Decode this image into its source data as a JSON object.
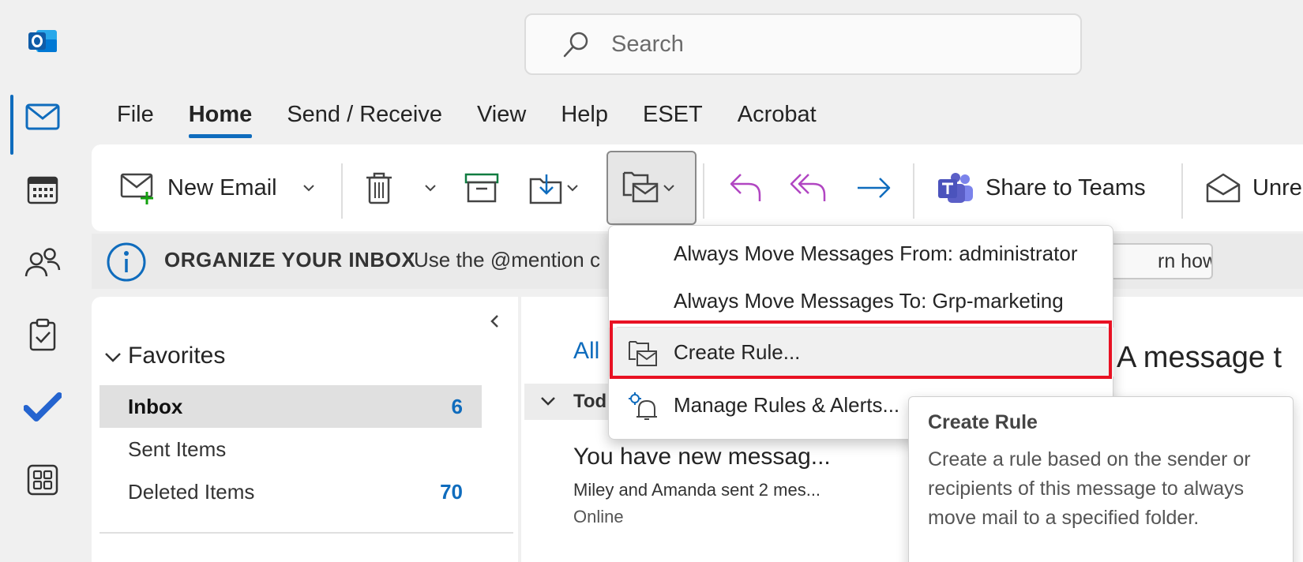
{
  "search": {
    "placeholder": "Search"
  },
  "menu": {
    "tabs": [
      {
        "label": "File"
      },
      {
        "label": "Home"
      },
      {
        "label": "Send / Receive"
      },
      {
        "label": "View"
      },
      {
        "label": "Help"
      },
      {
        "label": "ESET"
      },
      {
        "label": "Acrobat"
      }
    ]
  },
  "ribbon": {
    "new_email": "New Email",
    "share_to_teams": "Share to Teams",
    "unread": "Unre"
  },
  "infobar": {
    "title": "ORGANIZE YOUR INBOX",
    "text": "Use the @mention c",
    "learn_how": "rn how"
  },
  "folders": {
    "favorites_label": "Favorites",
    "items": [
      {
        "label": "Inbox",
        "count": "6"
      },
      {
        "label": "Sent Items",
        "count": ""
      },
      {
        "label": "Deleted Items",
        "count": "70"
      }
    ]
  },
  "message_list": {
    "tab_all": "All",
    "group_label": "Tod",
    "message": {
      "subject": "You have new messag...",
      "preview": "Miley and Amanda sent 2 mes...",
      "status": "Online"
    }
  },
  "reading_pane": {
    "title": "A message t"
  },
  "rules_menu": {
    "items": [
      {
        "label": "Always Move Messages From: administrator"
      },
      {
        "label": "Always Move Messages To: Grp-marketing"
      },
      {
        "label": "Create Rule..."
      },
      {
        "label": "Manage Rules & Alerts..."
      }
    ]
  },
  "tooltip": {
    "title": "Create Rule",
    "body": "Create a rule based on the sender or recipients of this message to always move mail to a specified folder."
  },
  "colors": {
    "accent": "#0f6cbd",
    "highlight_box": "#e81123",
    "teams": "#5b5fc7",
    "reply": "#b146c2"
  }
}
